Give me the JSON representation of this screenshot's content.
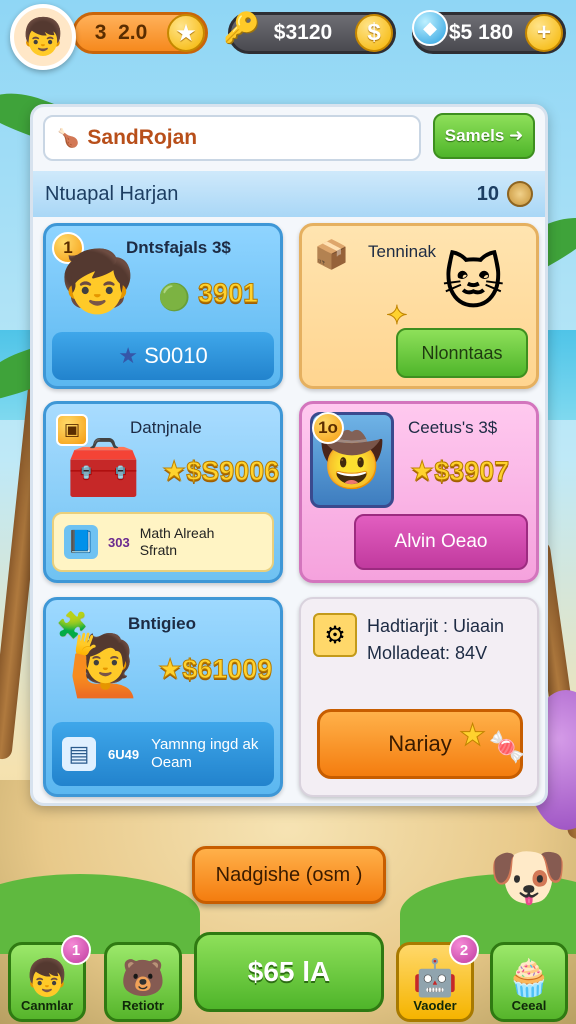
{
  "hud": {
    "level_value": "2.0",
    "level_prefix": "3",
    "coins_value": "$3120",
    "gems_value": "$5 180"
  },
  "search": {
    "value": "SandRojan",
    "button_label": "Samels"
  },
  "list_header": {
    "title": "Ntuapal Harjan",
    "count": "10"
  },
  "cards": [
    {
      "badge": "1",
      "title": "Dntsfajals 3$",
      "price": "3901",
      "bottom_value": "S0010"
    },
    {
      "title": "Tenninak",
      "button_label": "Nlonntaas"
    },
    {
      "title": "Datnjnale",
      "price": "$S9006",
      "sub_line1": "Math Alreah",
      "sub_line2": "Sfratn",
      "sub_prefix": "303"
    },
    {
      "badge": "1o",
      "title": "Ceetus's 3$",
      "price": "$3907",
      "button_label": "Alvin Oeao"
    },
    {
      "title": "Bntigieo",
      "price": "$61009",
      "sub_line1": "Yamnng ingd ak",
      "sub_line2": "Oeam",
      "sub_prefix": "6U49"
    },
    {
      "line1": "Hadtiarjit : Uiaain",
      "line2": "Molladeat: 84V",
      "button_label": "Nariay"
    }
  ],
  "cta_label": "Nadgishe (osm )",
  "nav": {
    "item1_label": "Canmlar",
    "item1_badge": "1",
    "item2_label": "Retiotr",
    "center_value": "$65 lA",
    "item4_label": "Vaoder",
    "item4_badge": "2",
    "item5_label": "Ceeal"
  }
}
